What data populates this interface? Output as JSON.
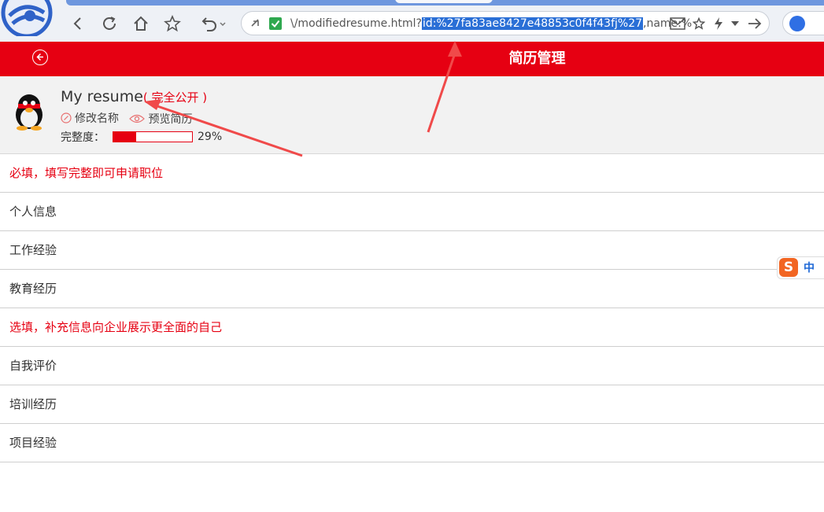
{
  "browser": {
    "url_prefix": "\\/modifiedresume.html?",
    "url_selected": "id:%27fa83ae8427e48853c0f4f43fj%27",
    "url_suffix": ",name:%"
  },
  "header": {
    "title": "简历管理"
  },
  "resume": {
    "name": "My resume",
    "visibility": "( 完全公开 )",
    "rename_label": "修改名称",
    "preview_label": "预览简历",
    "completeness_label": "完整度：",
    "completeness_percent": "29%",
    "completeness_value": 0.29
  },
  "sections": [
    {
      "type": "section",
      "label": "必填，填写完整即可申请职位"
    },
    {
      "type": "item",
      "label": "个人信息"
    },
    {
      "type": "item",
      "label": "工作经验"
    },
    {
      "type": "item",
      "label": "教育经历"
    },
    {
      "type": "section",
      "label": "选填，补充信息向企业展示更全面的自己"
    },
    {
      "type": "item",
      "label": "自我评价"
    },
    {
      "type": "item",
      "label": "培训经历"
    },
    {
      "type": "item",
      "label": "项目经验"
    }
  ],
  "ime": {
    "logo": "S",
    "mode": "中"
  },
  "colors": {
    "brand_red": "#e60012",
    "selection_blue": "#2a6fd6",
    "annotation_red": "#f04a4a"
  }
}
